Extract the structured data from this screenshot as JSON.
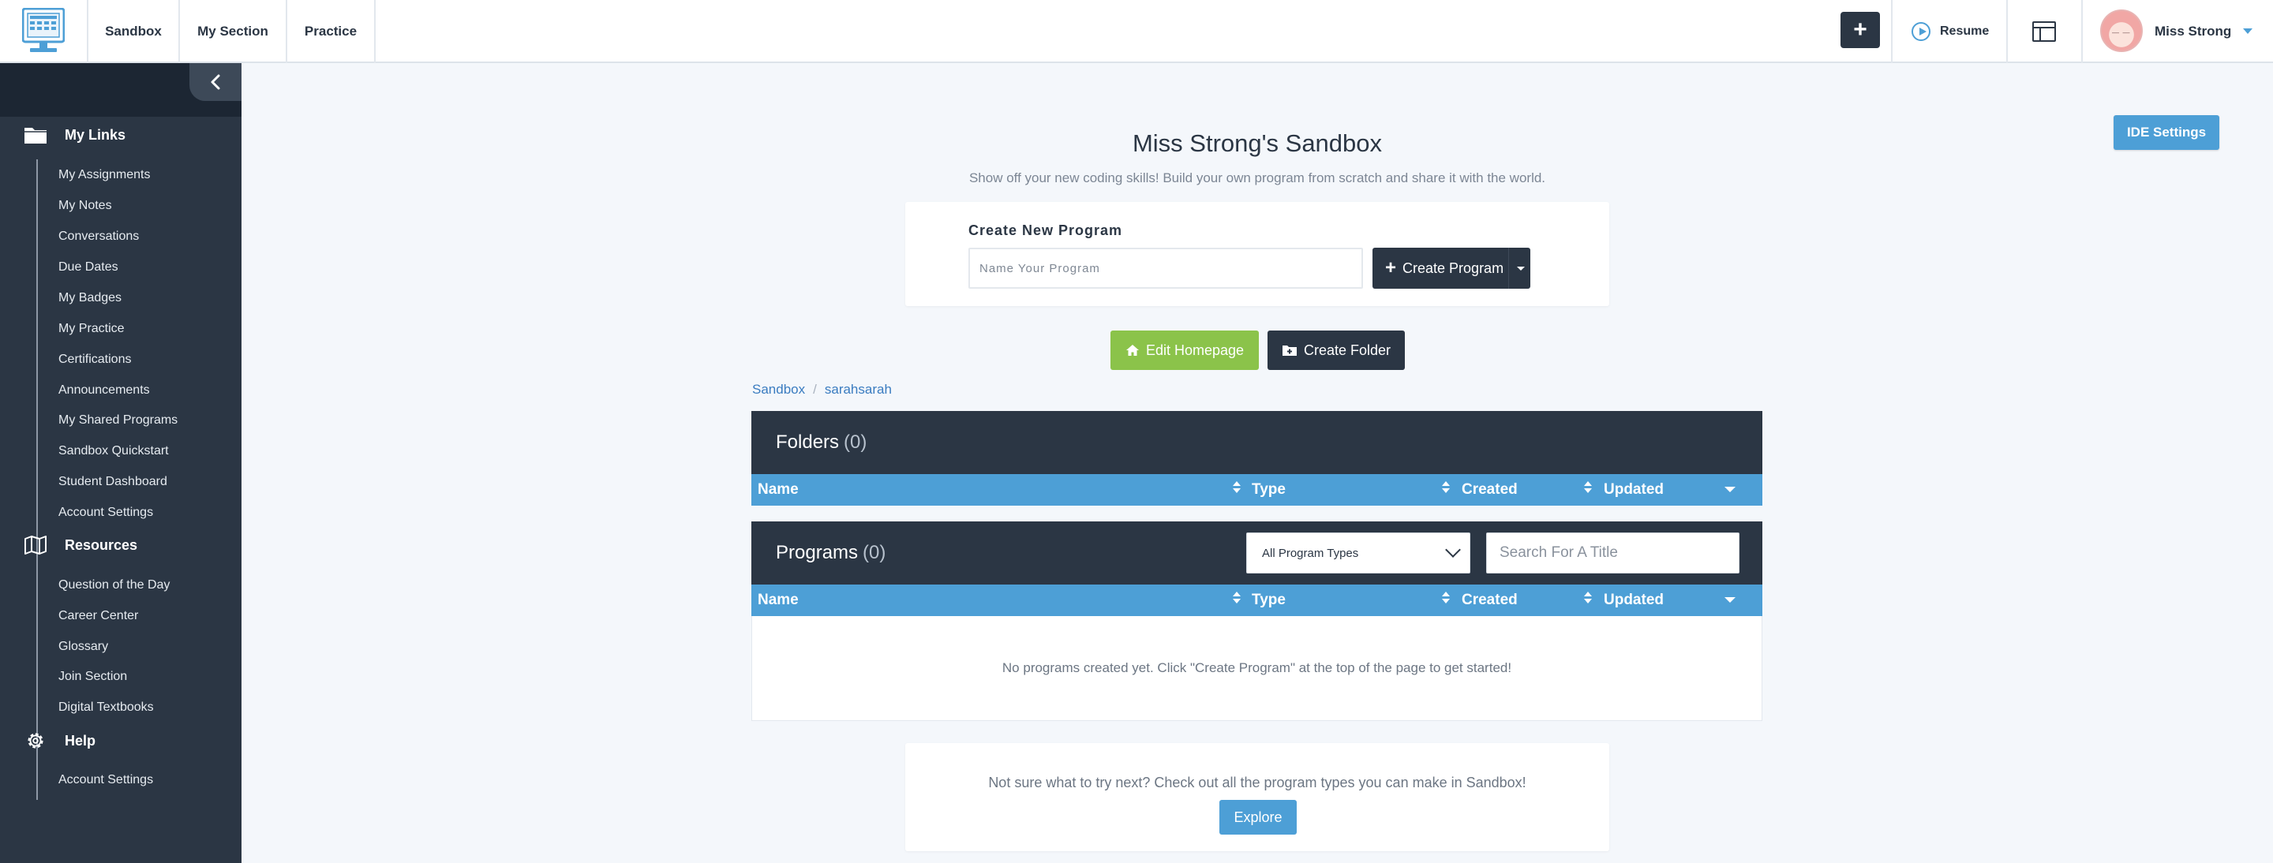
{
  "nav": {
    "tabs": [
      "Sandbox",
      "My Section",
      "Practice"
    ],
    "resume": "Resume",
    "user": "Miss Strong"
  },
  "sidebar": {
    "my_links": {
      "title": "My Links",
      "items": [
        "My Assignments",
        "My Notes",
        "Conversations",
        "Due Dates",
        "My Badges",
        "My Practice",
        "Certifications",
        "Announcements",
        "My Shared Programs",
        "Sandbox Quickstart",
        "Student Dashboard",
        "Account Settings"
      ]
    },
    "resources": {
      "title": "Resources",
      "items": [
        "Question of the Day",
        "Career Center",
        "Glossary",
        "Join Section",
        "Digital Textbooks"
      ]
    },
    "help": {
      "title": "Help",
      "items": [
        "Account Settings"
      ]
    }
  },
  "main": {
    "ide_settings": "IDE Settings",
    "title": "Miss Strong's Sandbox",
    "subtitle": "Show off your new coding skills! Build your own program from scratch and share it with the world.",
    "create": {
      "label": "Create New Program",
      "placeholder": "Name Your Program",
      "button": "Create Program"
    },
    "edit_homepage": "Edit Homepage",
    "create_folder": "Create Folder",
    "breadcrumb": [
      "Sandbox",
      "sarahsarah"
    ],
    "folders": {
      "title": "Folders",
      "count": "(0)"
    },
    "programs": {
      "title": "Programs",
      "count": "(0)",
      "filter": "All Program Types",
      "search_placeholder": "Search For A Title",
      "empty": "No programs created yet. Click \"Create Program\" at the top of the page to get started!"
    },
    "columns": [
      "Name",
      "Type",
      "Created",
      "Updated"
    ],
    "explore": {
      "text": "Not sure what to try next? Check out all the program types you can make in Sandbox!",
      "button": "Explore"
    }
  },
  "colors": {
    "navy": "#2b3644",
    "blue": "#4d9fd6",
    "green": "#8bc34a",
    "background": "#f4f7fb"
  }
}
